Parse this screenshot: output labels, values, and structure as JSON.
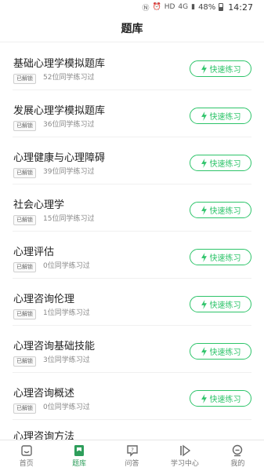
{
  "status_bar": {
    "network": "HD",
    "signal": "4G",
    "battery": "48%",
    "time": "14:27"
  },
  "header": {
    "title": "题库"
  },
  "colors": {
    "accent": "#2ec46a",
    "active_tab": "#2e9e5b"
  },
  "items": [
    {
      "title": "基础心理学模拟题库",
      "tag": "已解锁",
      "count": "52位同学练习过",
      "button": "快速练习"
    },
    {
      "title": "发展心理学模拟题库",
      "tag": "已解锁",
      "count": "36位同学练习过",
      "button": "快速练习"
    },
    {
      "title": "心理健康与心理障碍",
      "tag": "已解锁",
      "count": "39位同学练习过",
      "button": "快速练习"
    },
    {
      "title": "社会心理学",
      "tag": "已解锁",
      "count": "15位同学练习过",
      "button": "快速练习"
    },
    {
      "title": "心理评估",
      "tag": "已解锁",
      "count": "0位同学练习过",
      "button": "快速练习"
    },
    {
      "title": "心理咨询伦理",
      "tag": "已解锁",
      "count": "1位同学练习过",
      "button": "快速练习"
    },
    {
      "title": "心理咨询基础技能",
      "tag": "已解锁",
      "count": "3位同学练习过",
      "button": "快速练习"
    },
    {
      "title": "心理咨询概述",
      "tag": "已解锁",
      "count": "0位同学练习过",
      "button": "快速练习"
    }
  ],
  "partial_item": {
    "title": "心理咨询方法"
  },
  "tabs": [
    {
      "label": "首页",
      "icon": "home-icon"
    },
    {
      "label": "题库",
      "icon": "question-bank-icon"
    },
    {
      "label": "问答",
      "icon": "qa-icon"
    },
    {
      "label": "学习中心",
      "icon": "play-icon"
    },
    {
      "label": "我的",
      "icon": "profile-icon"
    }
  ]
}
